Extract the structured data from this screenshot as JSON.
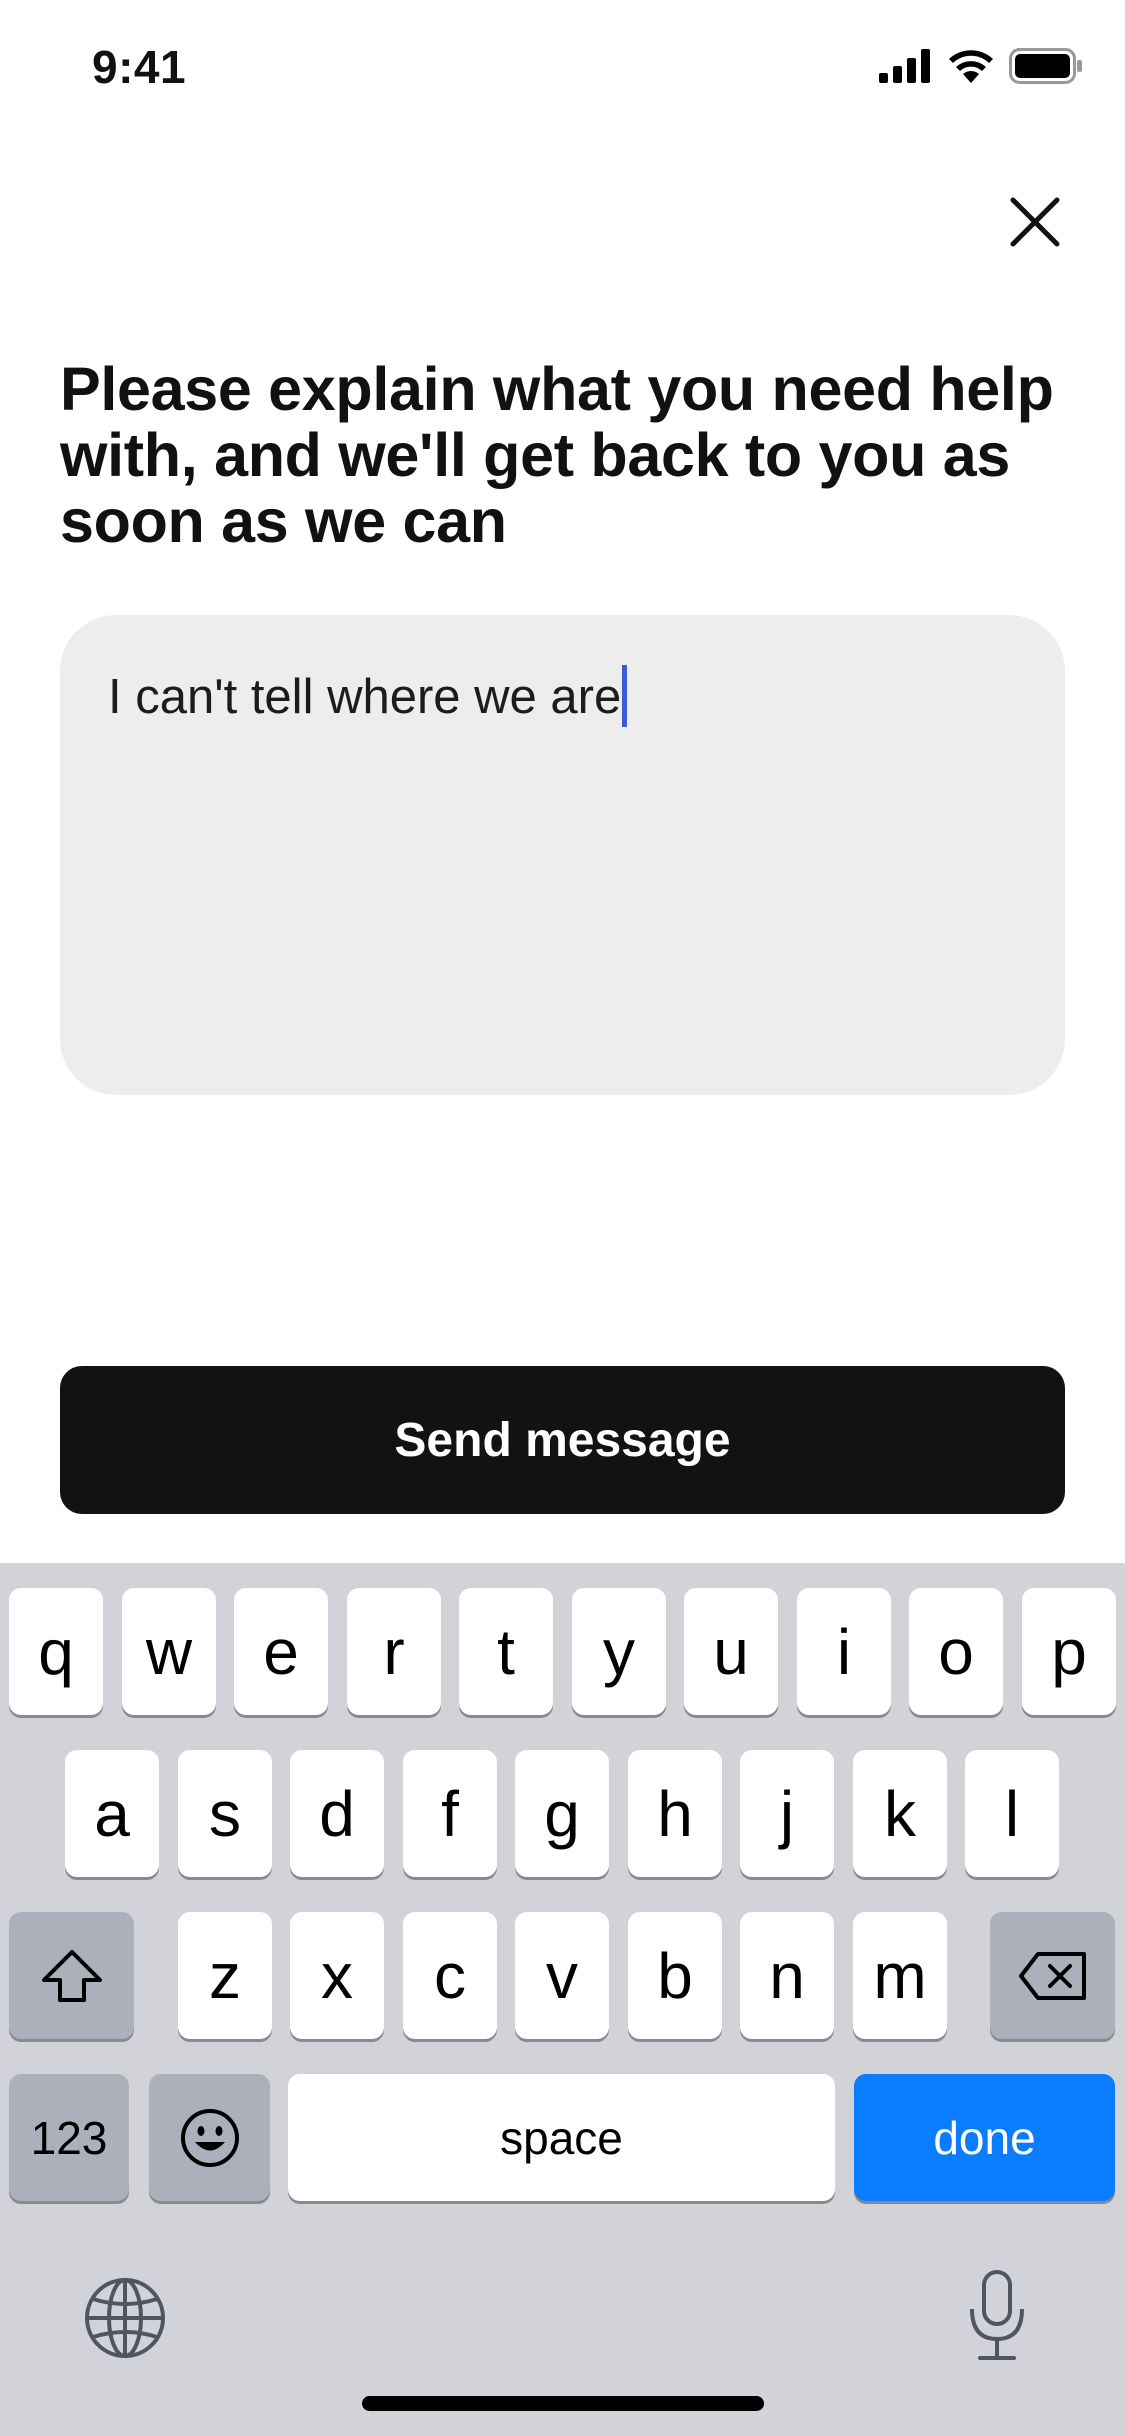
{
  "status_bar": {
    "time": "9:41"
  },
  "title": "Please explain what you need help with, and we'll get back to you as soon as we can",
  "message_field": {
    "value": "I can't tell where we are"
  },
  "send_button": {
    "label": "Send message"
  },
  "keyboard": {
    "row1": [
      "q",
      "w",
      "e",
      "r",
      "t",
      "y",
      "u",
      "i",
      "o",
      "p"
    ],
    "row2": [
      "a",
      "s",
      "d",
      "f",
      "g",
      "h",
      "j",
      "k",
      "l"
    ],
    "row3": [
      "z",
      "x",
      "c",
      "v",
      "b",
      "n",
      "m"
    ],
    "numbers_label": "123",
    "space_label": "space",
    "done_label": "done"
  },
  "colors": {
    "accent": "#0a7cff",
    "caret": "#3b5bdb",
    "button": "#121212",
    "field": "#eeedeb",
    "keyboard": "#d1d3d9"
  }
}
